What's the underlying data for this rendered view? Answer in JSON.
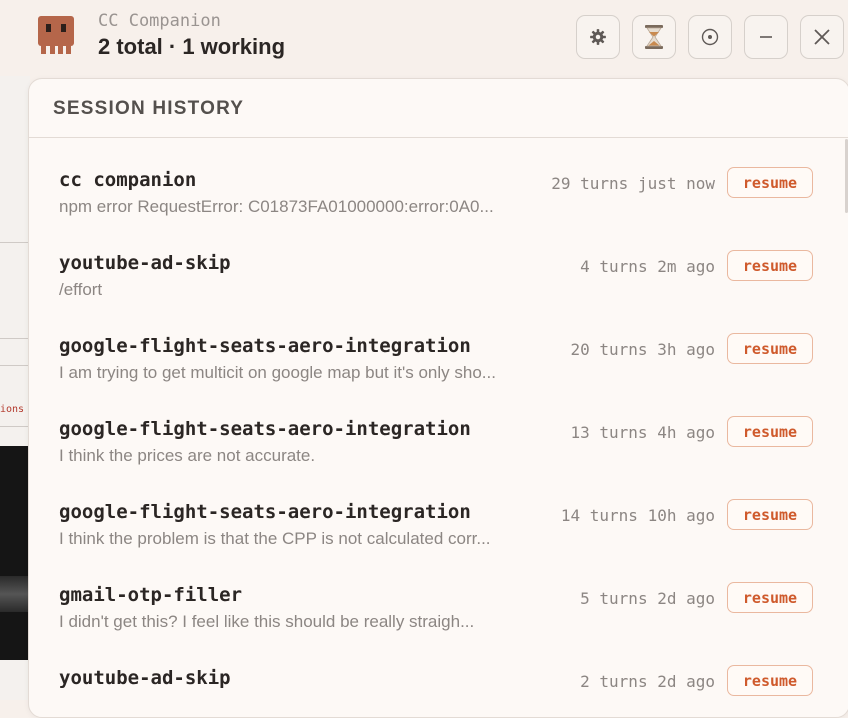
{
  "header": {
    "app_name": "CC Companion",
    "status": "2 total · 1 working",
    "buttons": [
      {
        "name": "settings",
        "icon": "gear-icon"
      },
      {
        "name": "history",
        "icon": "hourglass-icon"
      },
      {
        "name": "target",
        "icon": "target-icon"
      },
      {
        "name": "minimize",
        "icon": "minus-icon"
      },
      {
        "name": "close",
        "icon": "close-icon"
      }
    ]
  },
  "panel": {
    "title": "SESSION HISTORY",
    "resume_label": "resume",
    "sessions": [
      {
        "title": "cc companion",
        "subtitle": "npm error RequestError: C01873FA01000000:error:0A0...",
        "meta": "29 turns just now"
      },
      {
        "title": "youtube-ad-skip",
        "subtitle": "/effort",
        "meta": "4 turns 2m ago"
      },
      {
        "title": "google-flight-seats-aero-integration",
        "subtitle": "I am trying to get multicit on google map but it's only sho...",
        "meta": "20 turns 3h ago"
      },
      {
        "title": "google-flight-seats-aero-integration",
        "subtitle": "I think the prices are not accurate.",
        "meta": "13 turns 4h ago"
      },
      {
        "title": "google-flight-seats-aero-integration",
        "subtitle": "I think the problem is that the CPP is not calculated corr...",
        "meta": "14 turns 10h ago"
      },
      {
        "title": "gmail-otp-filler",
        "subtitle": "I didn't get this? I feel like this should be really straigh...",
        "meta": "5 turns 2d ago"
      },
      {
        "title": "youtube-ad-skip",
        "subtitle": "",
        "meta": "2 turns 2d ago"
      }
    ]
  },
  "background": {
    "fragment_text": "ions"
  },
  "colors": {
    "accent": "#cf5a2c",
    "logo": "#b5664a",
    "background": "#f7f0eb"
  }
}
